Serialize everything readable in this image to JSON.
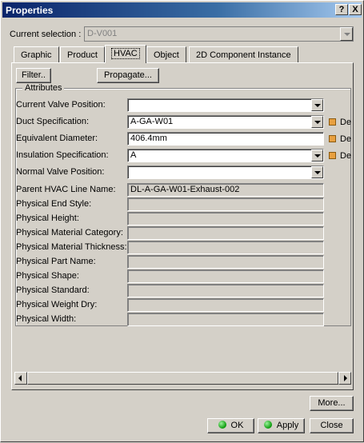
{
  "window": {
    "title": "Properties",
    "help_label": "?",
    "close_label": "X"
  },
  "current_selection": {
    "label": "Current selection :",
    "value": "D-V001"
  },
  "tabs": [
    {
      "label": "Graphic",
      "active": false
    },
    {
      "label": "Product",
      "active": false
    },
    {
      "label": "HVAC",
      "active": true
    },
    {
      "label": "Object",
      "active": false
    },
    {
      "label": "2D Component Instance",
      "active": false
    }
  ],
  "buttons": {
    "filter": "Filter..",
    "propagate": "Propagate...",
    "more": "More...",
    "ok": "OK",
    "apply": "Apply",
    "close": "Close"
  },
  "attributes": {
    "group_label": "Attributes",
    "rows": [
      {
        "label": "Current Valve Position:",
        "value": "",
        "combo": true,
        "flag": false,
        "readonly": false
      },
      {
        "label": "Duct Specification:",
        "value": "A-GA-W01",
        "combo": true,
        "flag": true,
        "flag_text": "De",
        "readonly": false
      },
      {
        "label": "Equivalent Diameter:",
        "value": "406.4mm",
        "combo": false,
        "flag": true,
        "flag_text": "De",
        "readonly": false
      },
      {
        "label": "Insulation Specification:",
        "value": "A",
        "combo": true,
        "flag": true,
        "flag_text": "De",
        "readonly": false
      },
      {
        "label": "Normal Valve Position:",
        "value": "",
        "combo": true,
        "flag": false,
        "readonly": false
      },
      {
        "label": "Parent HVAC Line Name:",
        "value": "DL-A-GA-W01-Exhaust-002",
        "combo": false,
        "flag": false,
        "readonly": true
      },
      {
        "label": "Physical End Style:",
        "value": "",
        "combo": false,
        "flag": false,
        "readonly": true
      },
      {
        "label": "Physical Height:",
        "value": "",
        "combo": false,
        "flag": false,
        "readonly": true
      },
      {
        "label": "Physical Material Category:",
        "value": "",
        "combo": false,
        "flag": false,
        "readonly": true
      },
      {
        "label": "Physical Material Thickness:",
        "value": "",
        "combo": false,
        "flag": false,
        "readonly": true
      },
      {
        "label": "Physical Part Name:",
        "value": "",
        "combo": false,
        "flag": false,
        "readonly": true
      },
      {
        "label": "Physical Shape:",
        "value": "",
        "combo": false,
        "flag": false,
        "readonly": true
      },
      {
        "label": "Physical Standard:",
        "value": "",
        "combo": false,
        "flag": false,
        "readonly": true
      },
      {
        "label": "Physical Weight Dry:",
        "value": "",
        "combo": false,
        "flag": false,
        "readonly": true
      },
      {
        "label": "Physical Width:",
        "value": "",
        "combo": false,
        "flag": false,
        "readonly": true
      }
    ]
  },
  "colors": {
    "title_bar": "#0a246a",
    "face": "#d4d0c8",
    "flag": "#e8a040",
    "ok_indicator": "#0a9a0a"
  },
  "icons": {
    "ok": "green-dot-icon",
    "apply": "green-dot-icon"
  }
}
